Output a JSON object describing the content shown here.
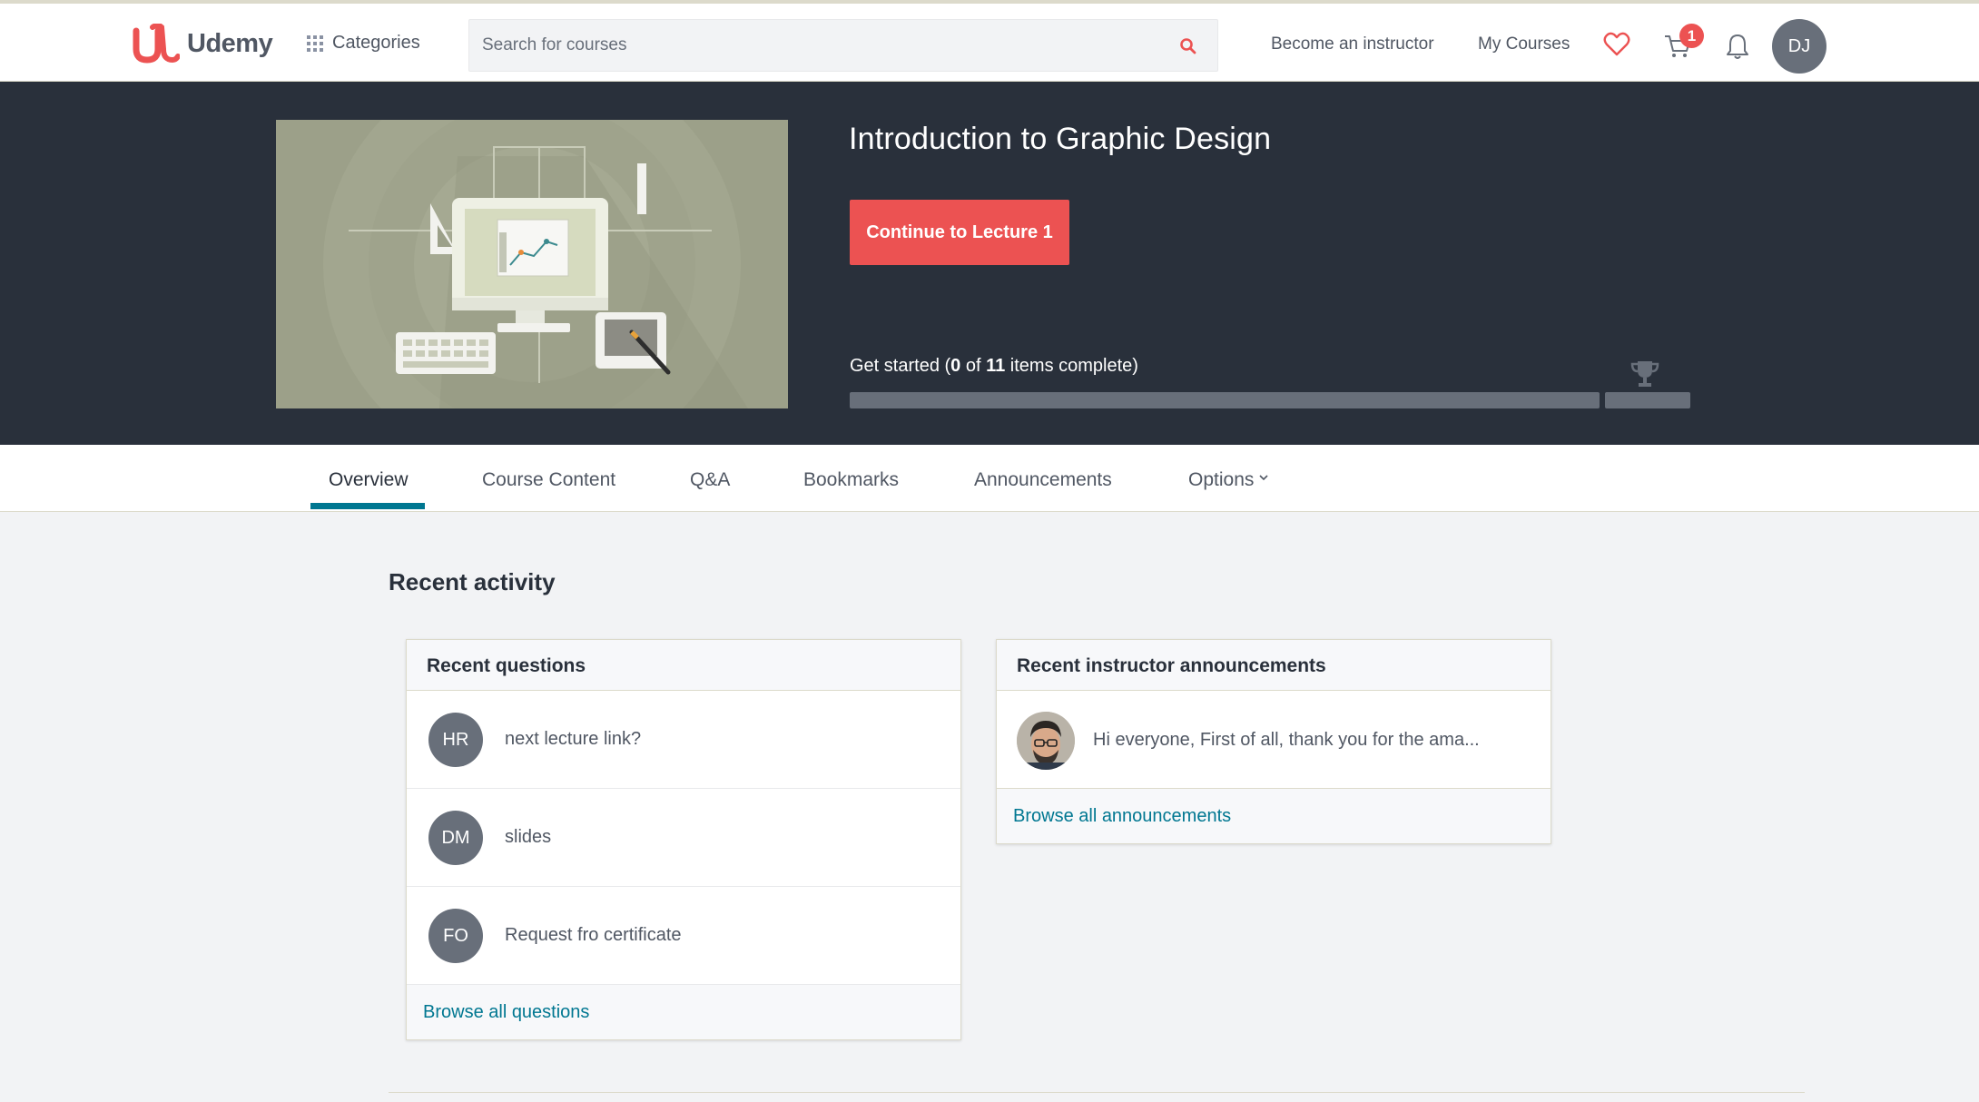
{
  "header": {
    "brand": "Udemy",
    "categories_label": "Categories",
    "search_placeholder": "Search for courses",
    "become_instructor": "Become an instructor",
    "my_courses": "My Courses",
    "cart_count": "1",
    "user_initials": "DJ",
    "icons": [
      "udemy-logo",
      "grid-icon",
      "search-icon",
      "heart-icon",
      "cart-icon",
      "bell-icon"
    ]
  },
  "hero": {
    "course_title": "Introduction to Graphic Design",
    "continue_button": "Continue to Lecture 1",
    "progress_prefix": "Get started (",
    "progress_completed": "0",
    "progress_of": " of ",
    "progress_total": "11",
    "progress_suffix": " items complete)",
    "progress_fraction": 0,
    "colors": {
      "button": "#ec5252",
      "hero_bg": "#29303b"
    }
  },
  "tabs": [
    {
      "label": "Overview",
      "active": true
    },
    {
      "label": "Course Content",
      "active": false
    },
    {
      "label": "Q&A",
      "active": false
    },
    {
      "label": "Bookmarks",
      "active": false
    },
    {
      "label": "Announcements",
      "active": false
    },
    {
      "label": "Options",
      "active": false
    }
  ],
  "recent_activity": {
    "title": "Recent activity",
    "questions": {
      "header": "Recent questions",
      "items": [
        {
          "initials": "HR",
          "text": "next lecture link?"
        },
        {
          "initials": "DM",
          "text": "slides"
        },
        {
          "initials": "FO",
          "text": "Request fro certificate"
        }
      ],
      "footer_link": "Browse all questions"
    },
    "announcements": {
      "header": "Recent instructor announcements",
      "items": [
        {
          "text": "Hi everyone, First of all, thank you for the ama..."
        }
      ],
      "footer_link": "Browse all announcements"
    }
  },
  "accent_color": "#007791"
}
